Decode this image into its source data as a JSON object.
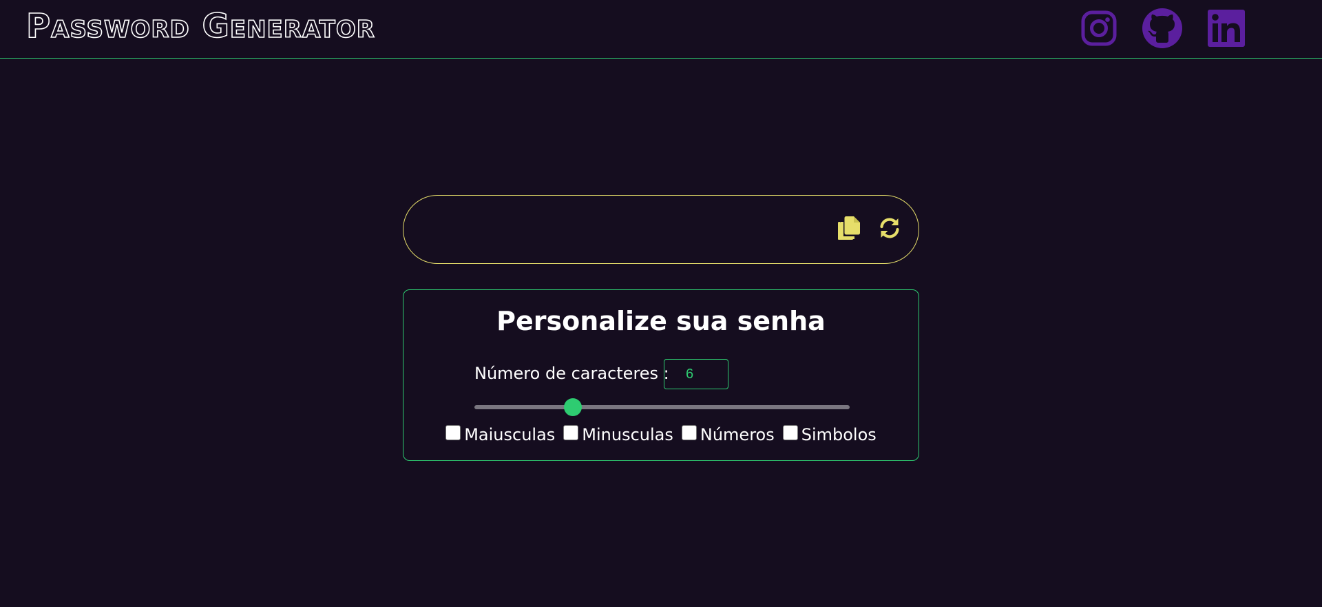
{
  "header": {
    "logo_text": "Password Generator",
    "social": [
      {
        "name": "instagram-icon",
        "color": "#5b1f9e"
      },
      {
        "name": "github-icon",
        "color": "#5b1f9e"
      },
      {
        "name": "linkedin-icon",
        "color": "#5b1f9e"
      }
    ]
  },
  "password": {
    "value": "",
    "copy_icon": "copy-icon",
    "refresh_icon": "refresh-icon",
    "accent": "#e6de6a"
  },
  "panel": {
    "title": "Personalize sua senha",
    "length_label": "Número de caracteres :",
    "length_value": "6",
    "slider": {
      "min": 1,
      "max": 20,
      "value": 6,
      "accent": "#2ecc71"
    },
    "options": [
      {
        "label": "Maiusculas",
        "checked": false
      },
      {
        "label": "Minusculas",
        "checked": false
      },
      {
        "label": "Números",
        "checked": false
      },
      {
        "label": "Simbolos",
        "checked": false
      }
    ]
  },
  "colors": {
    "background": "#150d1f",
    "green": "#2ecc71",
    "yellow": "#e6de6a",
    "purple": "#5b1f9e"
  }
}
